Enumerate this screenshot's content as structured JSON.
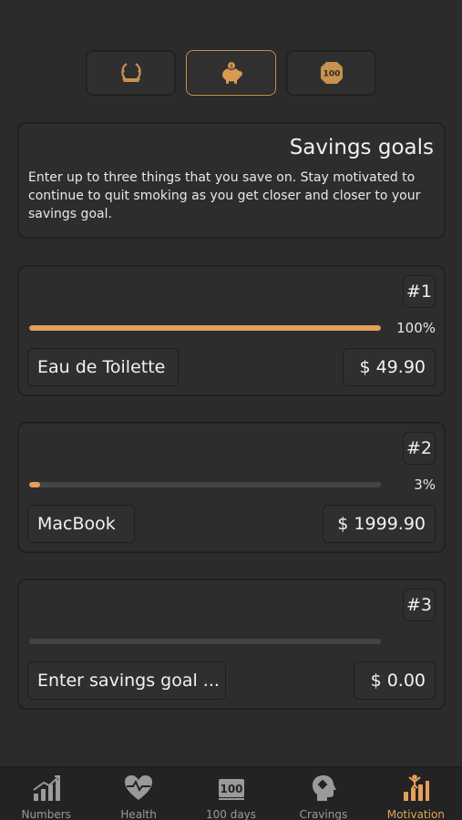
{
  "colors": {
    "accent": "#e3a05a",
    "background": "#2b2b2b",
    "card": "#2d2d2d",
    "track": "#444444",
    "inactive": "#9a9a9a"
  },
  "segments": [
    {
      "icon": "laurel-badge-icon",
      "active": false
    },
    {
      "icon": "piggy-bank-icon",
      "active": true
    },
    {
      "icon": "hundred-badge-icon",
      "active": false,
      "text": "100"
    }
  ],
  "intro": {
    "title": "Savings goals",
    "text": "Enter up to three things that you save on. Stay motivated to continue to quit smoking as you get closer and closer to your savings goal."
  },
  "goals": [
    {
      "number": "#1",
      "progress": 1.0,
      "percent_label": "100%",
      "name": "Eau de Toilette",
      "price": "$ 49.90"
    },
    {
      "number": "#2",
      "progress": 0.03,
      "percent_label": "3%",
      "name": "MacBook",
      "price": "$ 1999.90"
    },
    {
      "number": "#3",
      "progress": 0.0,
      "percent_label": "",
      "name": "Enter savings goal ...",
      "price": "$ 0.00"
    }
  ],
  "tabs": [
    {
      "label": "Numbers",
      "icon": "bar-chart-icon",
      "active": false
    },
    {
      "label": "Health",
      "icon": "heart-pulse-icon",
      "active": false
    },
    {
      "label": "100 days",
      "icon": "hundred-icon",
      "active": false,
      "icon_text": "100"
    },
    {
      "label": "Cravings",
      "icon": "head-icon",
      "active": false
    },
    {
      "label": "Motivation",
      "icon": "motivation-icon",
      "active": true
    }
  ]
}
